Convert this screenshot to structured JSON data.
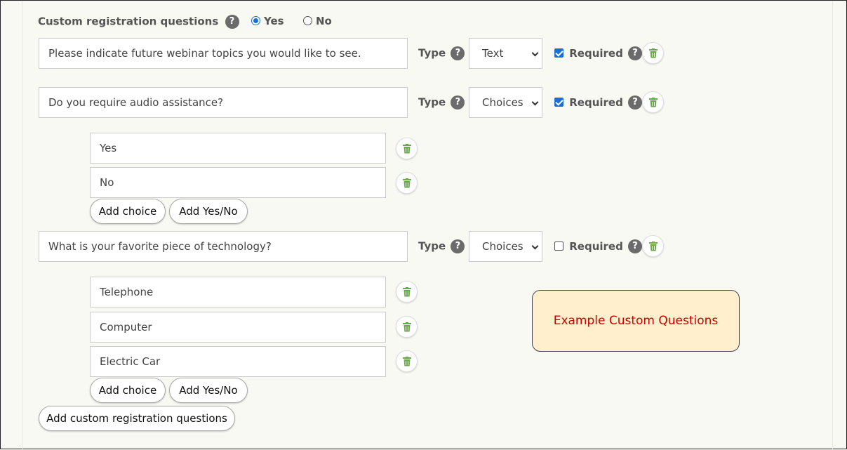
{
  "header": {
    "title": "Custom registration questions",
    "help": "?",
    "yes_label": "Yes",
    "no_label": "No",
    "selected": "Yes"
  },
  "labels": {
    "type": "Type",
    "required": "Required",
    "help": "?",
    "add_choice": "Add choice",
    "add_yes_no": "Add Yes/No",
    "add_question": "Add custom registration questions"
  },
  "questions": [
    {
      "text": "Please indicate future webinar topics you would like to see.",
      "type": "Text",
      "required": true,
      "choices": []
    },
    {
      "text": "Do you require audio assistance?",
      "type": "Choices",
      "required": true,
      "choices": [
        "Yes",
        "No"
      ]
    },
    {
      "text": "What is your favorite piece of technology?",
      "type": "Choices",
      "required": false,
      "choices": [
        "Telephone",
        "Computer",
        "Electric Car"
      ]
    }
  ],
  "callout": {
    "text": "Example Custom Questions"
  },
  "colors": {
    "accent": "#1a6fd6",
    "trash": "#6aaa4a",
    "callout_bg": "#ffefcc",
    "callout_text": "#cc0000"
  }
}
